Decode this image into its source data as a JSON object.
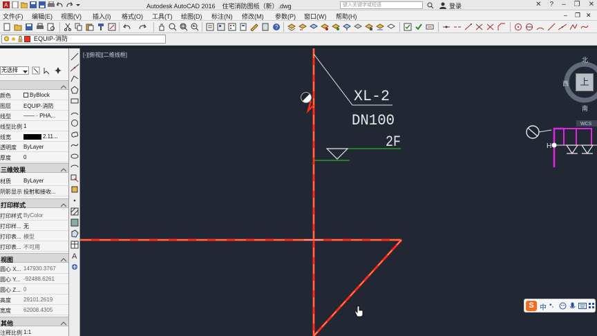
{
  "window": {
    "app_title": "Autodesk AutoCAD 2016",
    "file_title": "住宅消防图纸（新）.dwg",
    "search_placeholder": "键入关键字或短语",
    "login_label": "登录"
  },
  "menu": {
    "items": [
      "文件(F)",
      "编辑(E)",
      "视图(V)",
      "插入(I)",
      "格式(O)",
      "工具(T)",
      "绘图(D)",
      "标注(N)",
      "修改(M)",
      "参数(P)",
      "窗口(W)",
      "帮助(H)"
    ]
  },
  "layer": {
    "current": "EQUIP-消防"
  },
  "properties": {
    "selector": "无选择",
    "sections": {
      "general": [
        {
          "key": "颜色",
          "value": "ByBlock"
        },
        {
          "key": "图层",
          "value": "EQUIP-消防"
        },
        {
          "key": "线型",
          "value": "—— · PHA..."
        },
        {
          "key": "线型比例",
          "value": "1"
        },
        {
          "key": "线宽",
          "value": "2.11..."
        },
        {
          "key": "透明度",
          "value": "ByLayer"
        },
        {
          "key": "厚度",
          "value": "0"
        }
      ],
      "effects_title": "三维效果",
      "effects": [
        {
          "key": "材质",
          "value": "ByLayer"
        },
        {
          "key": "阴影显示",
          "value": "投射和接收..."
        }
      ],
      "plot_title": "打印样式",
      "plot": [
        {
          "key": "打印样式",
          "value": "ByColor"
        },
        {
          "key": "打印样...",
          "value": "无"
        },
        {
          "key": "打印表...",
          "value": "模型"
        },
        {
          "key": "打印表...",
          "value": "不可用"
        }
      ],
      "view_title": "视图",
      "view": [
        {
          "key": "圆心 X...",
          "value": "147930.3767"
        },
        {
          "key": "圆心 Y...",
          "value": "-92488.6261"
        },
        {
          "key": "圆心 Z...",
          "value": "0"
        },
        {
          "key": "高度",
          "value": "29101.2619"
        },
        {
          "key": "宽度",
          "value": "62008.4305"
        }
      ],
      "misc_title": "其他",
      "misc": [
        {
          "key": "注释比例",
          "value": "1:1"
        }
      ]
    }
  },
  "viewport": {
    "label": "[-][俯视][二维线框]",
    "viewcube": {
      "north": "北",
      "south": "南",
      "west": "西",
      "top": "上"
    }
  },
  "drawing": {
    "riser_tag": "XL-2",
    "pipe_size": "DN100",
    "floor_label": "2F",
    "wcs_label": "WCS",
    "colors": {
      "pipe": "#ff2a1a",
      "leader": "#e6e6e6",
      "floor_line": "#2fd12f",
      "magenta": "#e026e0",
      "text": "#e6e6e6",
      "background": "#212833"
    }
  },
  "ime": {
    "brand": "S",
    "mode": "中"
  }
}
